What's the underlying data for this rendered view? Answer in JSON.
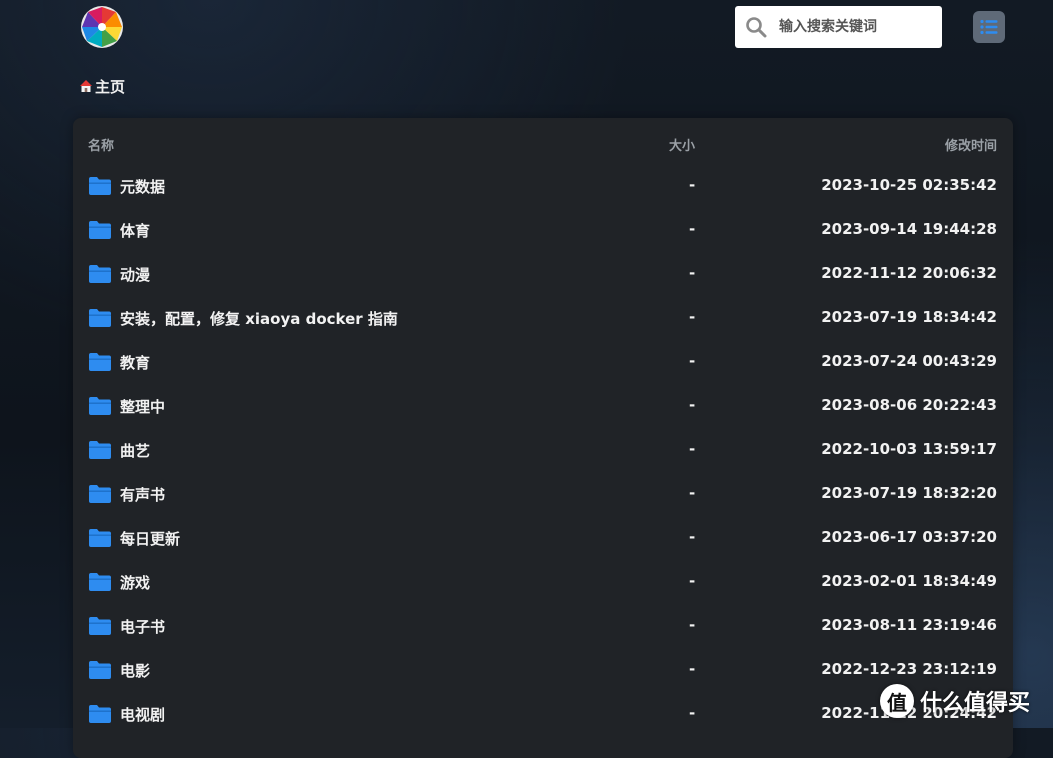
{
  "header": {
    "logo_name": "xiaoya-logo",
    "search": {
      "placeholder": "输入搜索关键词",
      "value": ""
    },
    "menu_icon": "list-icon"
  },
  "breadcrumb": {
    "home_label": "主页"
  },
  "file_list": {
    "columns": {
      "name": "名称",
      "size": "大小",
      "mtime": "修改时间"
    },
    "rows": [
      {
        "name": "元数据",
        "size": "-",
        "mtime": "2023-10-25 02:35:42"
      },
      {
        "name": "体育",
        "size": "-",
        "mtime": "2023-09-14 19:44:28"
      },
      {
        "name": "动漫",
        "size": "-",
        "mtime": "2022-11-12 20:06:32"
      },
      {
        "name": "安装，配置，修复 xiaoya docker 指南",
        "size": "-",
        "mtime": "2023-07-19 18:34:42"
      },
      {
        "name": "教育",
        "size": "-",
        "mtime": "2023-07-24 00:43:29"
      },
      {
        "name": "整理中",
        "size": "-",
        "mtime": "2023-08-06 20:22:43"
      },
      {
        "name": "曲艺",
        "size": "-",
        "mtime": "2022-10-03 13:59:17"
      },
      {
        "name": "有声书",
        "size": "-",
        "mtime": "2023-07-19 18:32:20"
      },
      {
        "name": "每日更新",
        "size": "-",
        "mtime": "2023-06-17 03:37:20"
      },
      {
        "name": "游戏",
        "size": "-",
        "mtime": "2023-02-01 18:34:49"
      },
      {
        "name": "电子书",
        "size": "-",
        "mtime": "2023-08-11 23:19:46"
      },
      {
        "name": "电影",
        "size": "-",
        "mtime": "2022-12-23 23:12:19"
      },
      {
        "name": "电视剧",
        "size": "-",
        "mtime": "2022-11-12 20:24:42"
      }
    ]
  },
  "watermark": {
    "badge": "值",
    "text": "什么值得买"
  },
  "colors": {
    "folder": "#2e8cf0",
    "panel": "#202327",
    "menu_button": "#5f6a78",
    "menu_icon": "#2e8cf0"
  }
}
